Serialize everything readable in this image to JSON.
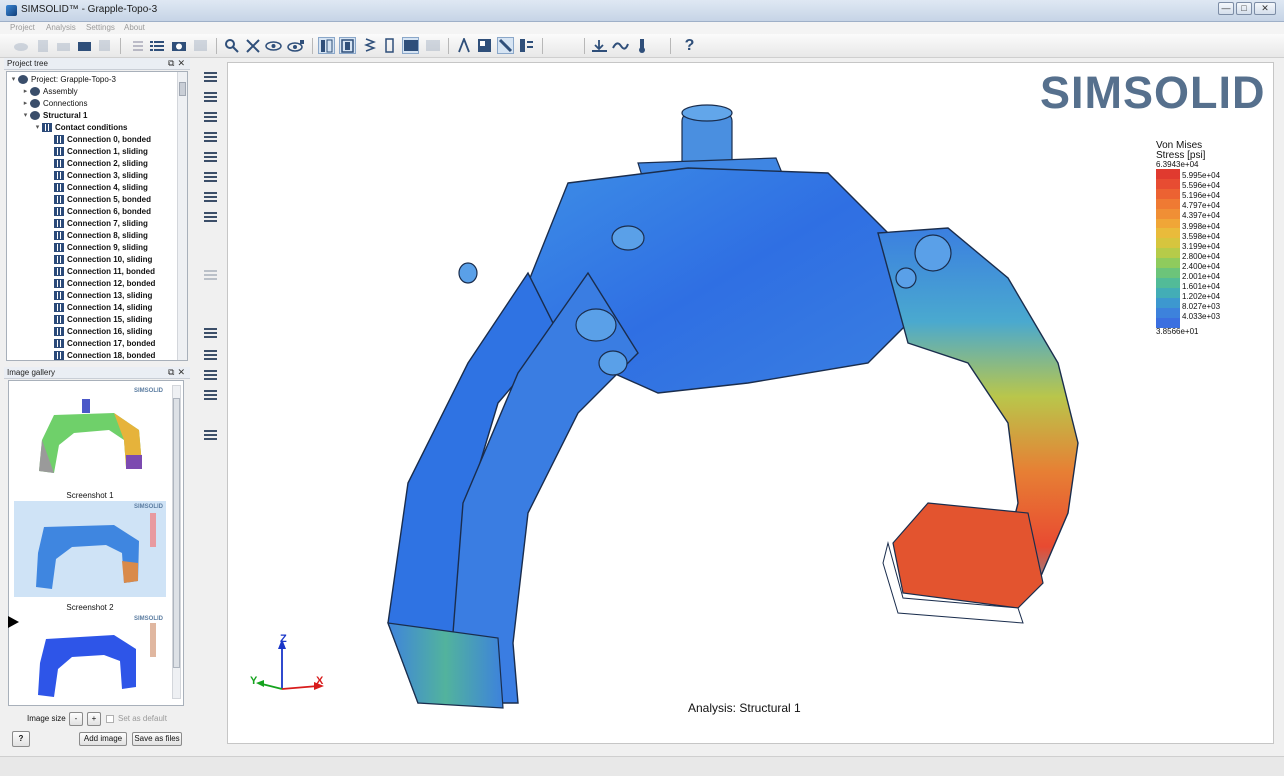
{
  "window": {
    "title": "SIMSOLID™ - Grapple-Topo-3",
    "controls": [
      "—",
      "□",
      "✕"
    ]
  },
  "menu": [
    "Project",
    "Analysis",
    "Settings",
    "About"
  ],
  "project_tree": {
    "title": "Project tree",
    "items": [
      {
        "label": "Project: Grapple-Topo-3",
        "level": 0,
        "bold": false,
        "expander": "▾"
      },
      {
        "label": "Assembly",
        "level": 1,
        "bold": false,
        "expander": "▸"
      },
      {
        "label": "Connections",
        "level": 1,
        "bold": false,
        "expander": "▸"
      },
      {
        "label": "Structural  1",
        "level": 1,
        "bold": true,
        "expander": "▾"
      },
      {
        "label": "Contact conditions",
        "level": 2,
        "bold": true,
        "expander": "▾"
      },
      {
        "label": "Connection 0, bonded",
        "level": 3,
        "bold": true,
        "expander": ""
      },
      {
        "label": "Connection 1, sliding",
        "level": 3,
        "bold": true,
        "expander": ""
      },
      {
        "label": "Connection 2, sliding",
        "level": 3,
        "bold": true,
        "expander": ""
      },
      {
        "label": "Connection 3, sliding",
        "level": 3,
        "bold": true,
        "expander": ""
      },
      {
        "label": "Connection 4, sliding",
        "level": 3,
        "bold": true,
        "expander": ""
      },
      {
        "label": "Connection 5, bonded",
        "level": 3,
        "bold": true,
        "expander": ""
      },
      {
        "label": "Connection 6, bonded",
        "level": 3,
        "bold": true,
        "expander": ""
      },
      {
        "label": "Connection 7, sliding",
        "level": 3,
        "bold": true,
        "expander": ""
      },
      {
        "label": "Connection 8, sliding",
        "level": 3,
        "bold": true,
        "expander": ""
      },
      {
        "label": "Connection 9, sliding",
        "level": 3,
        "bold": true,
        "expander": ""
      },
      {
        "label": "Connection 10, sliding",
        "level": 3,
        "bold": true,
        "expander": ""
      },
      {
        "label": "Connection 11, bonded",
        "level": 3,
        "bold": true,
        "expander": ""
      },
      {
        "label": "Connection 12, bonded",
        "level": 3,
        "bold": true,
        "expander": ""
      },
      {
        "label": "Connection 13, sliding",
        "level": 3,
        "bold": true,
        "expander": ""
      },
      {
        "label": "Connection 14, sliding",
        "level": 3,
        "bold": true,
        "expander": ""
      },
      {
        "label": "Connection 15, sliding",
        "level": 3,
        "bold": true,
        "expander": ""
      },
      {
        "label": "Connection 16, sliding",
        "level": 3,
        "bold": true,
        "expander": ""
      },
      {
        "label": "Connection 17, bonded",
        "level": 3,
        "bold": true,
        "expander": ""
      },
      {
        "label": "Connection 18, bonded",
        "level": 3,
        "bold": true,
        "expander": ""
      }
    ]
  },
  "image_gallery": {
    "title": "Image gallery",
    "thumb_brand": "SIMSOLID",
    "captions": [
      "Screenshot 1",
      "Screenshot 2"
    ],
    "image_size_label": "Image size",
    "minus": "-",
    "plus": "+",
    "set_default": "Set as default",
    "help": "?",
    "add_image": "Add image",
    "save_as_files": "Save as files"
  },
  "toolbar": {
    "help": "?"
  },
  "viewport": {
    "logo": "SIMSOLID",
    "analysis_label": "Analysis: Structural  1",
    "axes": {
      "x": "X",
      "y": "Y",
      "z": "Z"
    }
  },
  "legend": {
    "title_line1": "Von Mises",
    "title_line2": "Stress [psi]",
    "max": "6.3943e+04",
    "min": "3.8566e+01",
    "ticks": [
      "5.995e+04",
      "5.596e+04",
      "5.196e+04",
      "4.797e+04",
      "4.397e+04",
      "3.998e+04",
      "3.598e+04",
      "3.199e+04",
      "2.800e+04",
      "2.400e+04",
      "2.001e+04",
      "1.601e+04",
      "1.202e+04",
      "8.027e+03",
      "4.033e+03"
    ],
    "colors": [
      "#e03a2f",
      "#e74c32",
      "#ec6232",
      "#ef7a33",
      "#f08f35",
      "#f0a637",
      "#e9bb3b",
      "#d6c53e",
      "#b6cb49",
      "#8fcb5d",
      "#6cc47a",
      "#52bb98",
      "#43adb6",
      "#3d98cf",
      "#3d82dc",
      "#3b6fe0"
    ]
  }
}
